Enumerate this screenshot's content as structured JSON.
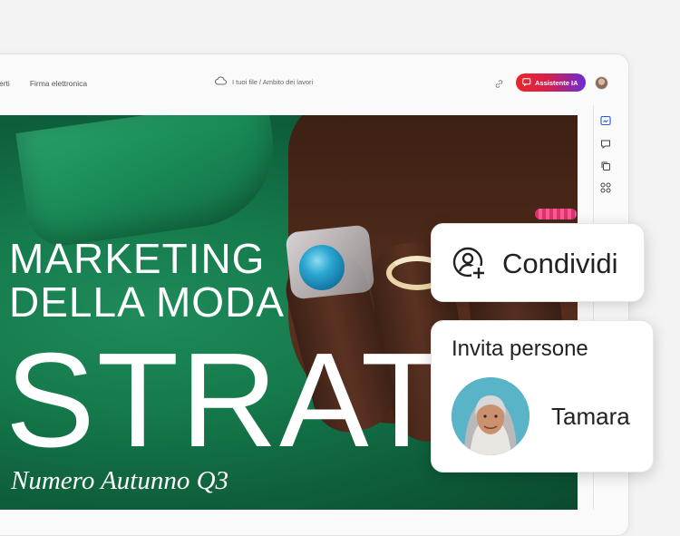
{
  "toolbar": {
    "nav_items": [
      "erti",
      "Firma elettronica"
    ],
    "breadcrumb": "I tuoi file / Ambito dei lavori",
    "ai_button_label": "Assistente IA"
  },
  "document": {
    "headline_line1": "MARKETING",
    "headline_line2": "DELLA MODA",
    "headline_big": "STRAT",
    "subtitle": "Numero Autunno Q3"
  },
  "share_card": {
    "label": "Condividi"
  },
  "invite_card": {
    "title": "Invita persone",
    "person_name": "Tamara"
  },
  "icons": {
    "cloud": "cloud-icon",
    "link": "link-icon",
    "ai": "ai-chat-icon",
    "rail": [
      "edit-panel-icon",
      "comment-icon",
      "copy-pages-icon",
      "apps-grid-icon"
    ],
    "share": "add-user-icon"
  },
  "colors": {
    "accent_red": "#e8272b",
    "accent_purple": "#6a2bd9",
    "canvas_green": "#157a4c"
  }
}
